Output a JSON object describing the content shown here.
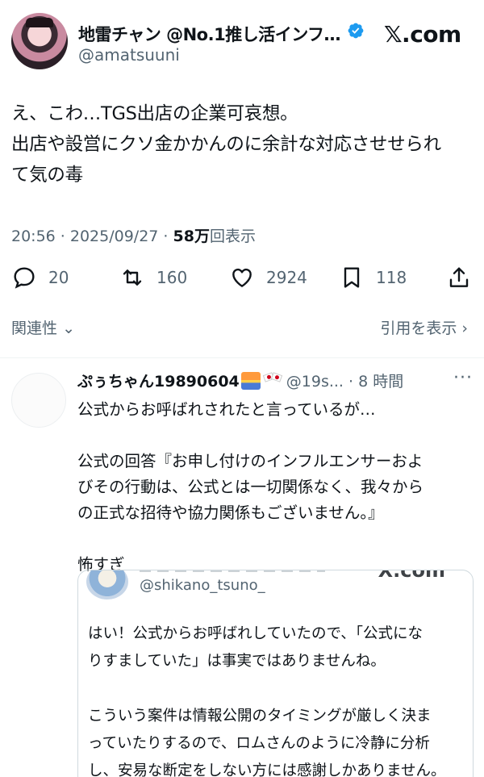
{
  "tweet": {
    "author_name": "地雷チャン @No.1推し活インフ…",
    "handle": "@amatsuuni",
    "site_logo": "𝕏.com",
    "text_lines": [
      "え、こわ…TGS出店の企業可哀想。",
      "出店や設営にクソ金かかんのに余計な対応させせられ",
      "て気の毒"
    ],
    "meta": {
      "time_date": "20:56 · 2025/09/27 · ",
      "views": "58万",
      "views_label": "回表示"
    },
    "actions": {
      "replies": "20",
      "retweets": "160",
      "likes": "2924",
      "bookmarks": "118"
    },
    "relevance_label": "関連性",
    "quotes_label": "引用を表示"
  },
  "reply": {
    "name": "ぷぅちゃん19890604",
    "handle_time": "@19s... · 8 時間",
    "more": "···",
    "lines": [
      "公式からお呼ばれされたと言っているが…",
      "",
      "公式の回答『お申し付けのインフルエンサーおよ",
      "びその行動は、公式とは一切関係なく、我々から",
      "の正式な招待や協力関係もございません。』",
      "",
      "怖すぎ"
    ],
    "embed": {
      "handle": "@shikano_tsuno_",
      "logo": "X.com",
      "lines": [
        "はい！公式からお呼ばれしていたので、「公式にな",
        "りすましていた」は事実ではありませんね。",
        "",
        "こういう案件は情報公開のタイミングが厳しく決ま",
        "っていたりするので、ロムさんのように冷静に分析",
        "し、安易な断定をしない方には感謝しかありません。"
      ]
    }
  },
  "icons": {
    "verified": "verified-badge-icon",
    "reply": "reply-icon",
    "retweet": "retweet-icon",
    "like": "heart-icon",
    "bookmark": "bookmark-icon",
    "share": "share-icon"
  },
  "colors": {
    "text": "#0f1419",
    "muted": "#536471",
    "verified": "#1d9bf0",
    "divider": "#eff3f4"
  }
}
